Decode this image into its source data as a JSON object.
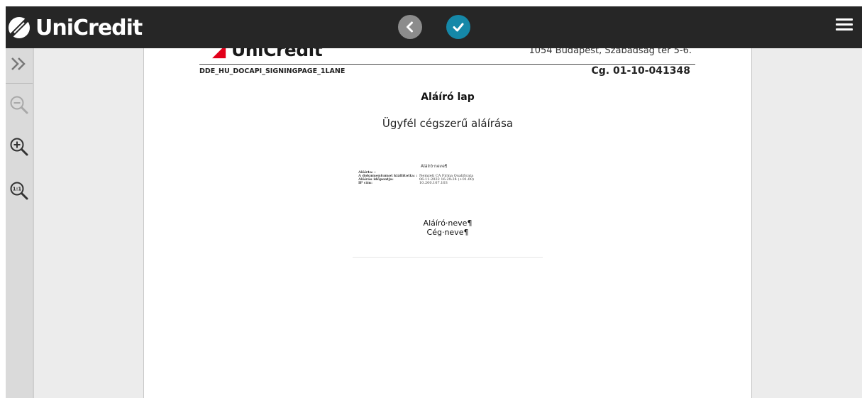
{
  "header": {
    "logo_text": "UniCredit",
    "back_icon": "chevron-left-icon",
    "confirm_icon": "checkmark-icon",
    "menu_icon": "hamburger-menu-icon"
  },
  "toolbar": {
    "items": [
      {
        "icon": "expand-double-chevron-icon"
      },
      {
        "icon": "zoom-out-icon"
      },
      {
        "icon": "zoom-in-icon"
      },
      {
        "icon": "zoom-actual-size-icon"
      }
    ]
  },
  "document": {
    "logo_text": "UniCredit",
    "address": "1054 Budapest, Szabadság tér 5-6.",
    "doc_code": "DDE_HU_DOCAPI_SIGNINGPAGE_1LANE",
    "reg_no": "Cg. 01-10-041348",
    "title": "Aláíró lap",
    "subtitle": "Ügyfél cégszerű aláírása",
    "stamp": {
      "name": "Aláíró·neve¶",
      "rows": [
        {
          "label": "Aláírta: :",
          "value": ""
        },
        {
          "label": "A dokumentumot kiállította: :",
          "value": "Nemzeti CA Firma Qualificata"
        },
        {
          "label": "Aláírás időpontja:",
          "value": "06-11-2022 16:29:24 (+01:00)"
        },
        {
          "label": "IP cím:",
          "value": "10.200.107.103"
        }
      ]
    },
    "signer_name": "Aláíró·neve¶",
    "company_name": "Cég·neve¶"
  },
  "colors": {
    "topbar": "#262626",
    "confirm": "#1588a8",
    "back": "#8c8c8c",
    "brand_red": "#e2001a"
  }
}
